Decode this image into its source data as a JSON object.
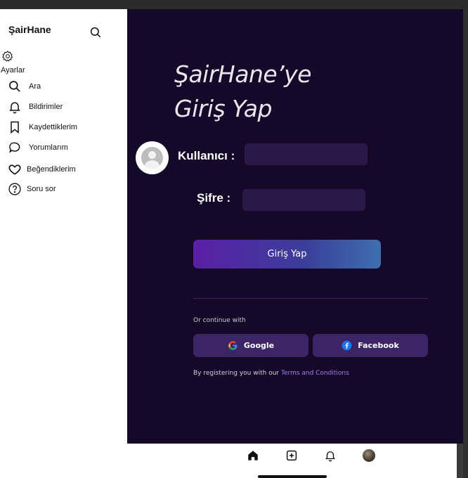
{
  "app": {
    "brand": "ŞairHane"
  },
  "sidebar": {
    "settings_label": "Ayarlar",
    "items": [
      {
        "label": "Ara",
        "icon": "search-icon"
      },
      {
        "label": "Bildirimler",
        "icon": "bell-icon"
      },
      {
        "label": "Kaydettiklerim",
        "icon": "bookmark-icon"
      },
      {
        "label": "Yorumlarım",
        "icon": "comment-icon"
      },
      {
        "label": "Beğendiklerim",
        "icon": "heart-icon"
      },
      {
        "label": "Soru sor",
        "icon": "question-icon"
      }
    ]
  },
  "login": {
    "title_line1": "ŞairHane’ye",
    "title_line2": "Giriş Yap",
    "username_label": "Kullanıcı :",
    "password_label": "Şifre :",
    "username_value": "",
    "password_value": "",
    "submit_label": "Giriş Yap",
    "continue_text": "Or continue with",
    "google_label": "Google",
    "facebook_label": "Facebook",
    "terms_prefix": "By registering you with our ",
    "terms_link": "Terms and Conditions"
  },
  "bottom_nav": {
    "icons": [
      "home-icon",
      "add-icon",
      "bell-icon",
      "profile-avatar"
    ]
  },
  "colors": {
    "panel_bg": "#150828",
    "field_bg": "#2a1848",
    "social_bg": "#3b2566",
    "link": "#a67bf0",
    "button_gradient_start": "#5a1fa6",
    "button_gradient_end": "#3e6fb0"
  }
}
